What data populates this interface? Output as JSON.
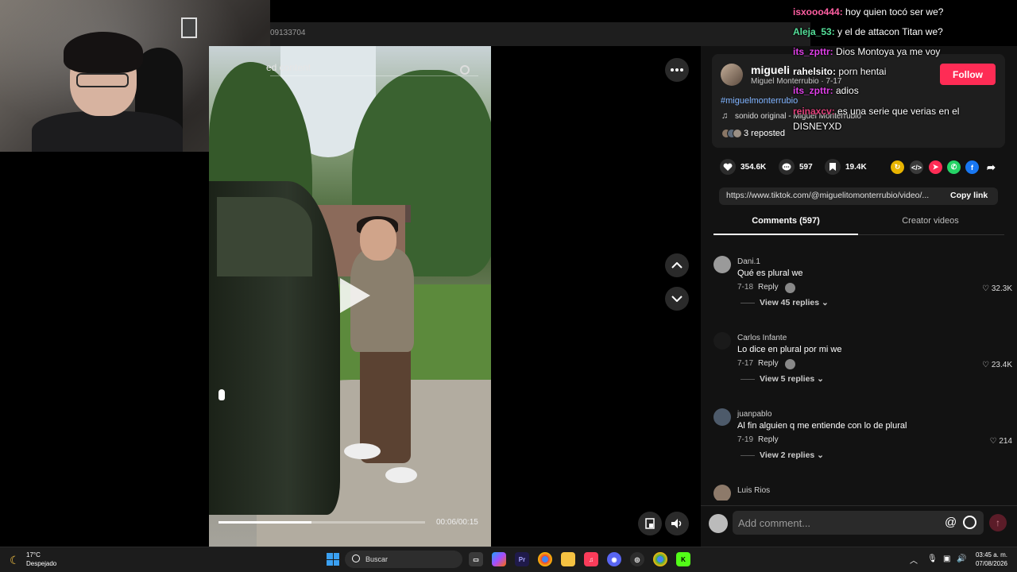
{
  "browser": {
    "url_fragment": "09133704"
  },
  "video": {
    "header_text": "ed content",
    "time": "00:06/00:15",
    "progress": 0.45
  },
  "post": {
    "username": "migueli",
    "display_name": "Miguel Monterrubio · 7-17",
    "follow_label": "Follow",
    "hashtag": "#miguelmonterrubio",
    "sound": "sonido original - Miguel Monterrubio",
    "reposted": "3 reposted",
    "likes": "354.6K",
    "comments": "597",
    "saves": "19.4K",
    "link": "https://www.tiktok.com/@miguelitomonterrubio/video/...",
    "copy_link": "Copy link"
  },
  "tabs": {
    "comments": "Comments (597)",
    "creator": "Creator videos"
  },
  "comments": [
    {
      "name": "Dani.1",
      "text": "Qué es plural we",
      "date": "7-18",
      "reply": "Reply",
      "likes": "32.3K",
      "replies": "View 45 replies"
    },
    {
      "name": "Carlos Infante",
      "text": "Lo dice en plural por mi we",
      "date": "7-17",
      "reply": "Reply",
      "likes": "23.4K",
      "replies": "View 5 replies"
    },
    {
      "name": "juanpablo",
      "text": "Al fin alguien q me entiende con lo de plural",
      "date": "7-19",
      "reply": "Reply",
      "likes": "214",
      "replies": "View 2 replies"
    },
    {
      "name": "Luis Rios"
    }
  ],
  "comment_input": {
    "placeholder": "Add comment..."
  },
  "chat": [
    {
      "user": "isxooo444:",
      "msg": " hoy quien tocó ser we?",
      "color": "#ff5fa2"
    },
    {
      "user": "Aleja_53:",
      "msg": " y el de attacon Titan we?",
      "color": "#55e09a"
    },
    {
      "user": "its_zpttr:",
      "msg": " Dios Montoya ya me voy",
      "color": "#e040e8"
    },
    {
      "user": "rahelsito:",
      "msg": " porn hentai",
      "color": "#ffffff"
    },
    {
      "user": "its_zpttr:",
      "msg": " adios",
      "color": "#e040e8"
    },
    {
      "user": "reinaxcv:",
      "msg": " es una serie que verias en el",
      "color": "#e0407a"
    },
    {
      "user": "",
      "msg": "DISNEYXD",
      "color": "#ffffff"
    }
  ],
  "taskbar": {
    "weather_temp": "17°C",
    "weather_desc": "Despejado",
    "search": "Buscar",
    "time": "03:45 a. m.",
    "date": "07/08/2026"
  }
}
